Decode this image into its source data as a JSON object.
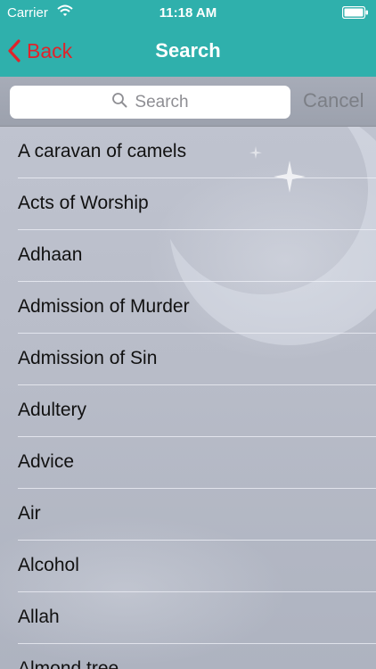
{
  "status_bar": {
    "carrier": "Carrier",
    "time": "11:18 AM",
    "wifi_icon": "wifi-icon",
    "battery_icon": "battery-icon"
  },
  "nav": {
    "back_label": "Back",
    "title": "Search",
    "back_icon": "chevron-left-icon"
  },
  "search": {
    "placeholder": "Search",
    "cancel_label": "Cancel",
    "icon": "search-icon"
  },
  "list": {
    "items": [
      {
        "label": "A caravan of camels"
      },
      {
        "label": "Acts of Worship"
      },
      {
        "label": "Adhaan"
      },
      {
        "label": "Admission of Murder"
      },
      {
        "label": "Admission of Sin"
      },
      {
        "label": "Adultery"
      },
      {
        "label": "Advice"
      },
      {
        "label": "Air"
      },
      {
        "label": "Alcohol"
      },
      {
        "label": "Allah"
      },
      {
        "label": "Almond tree"
      }
    ]
  },
  "colors": {
    "header": "#2fb0ac",
    "back_accent": "#e0232b",
    "title_text": "#ffffff"
  }
}
